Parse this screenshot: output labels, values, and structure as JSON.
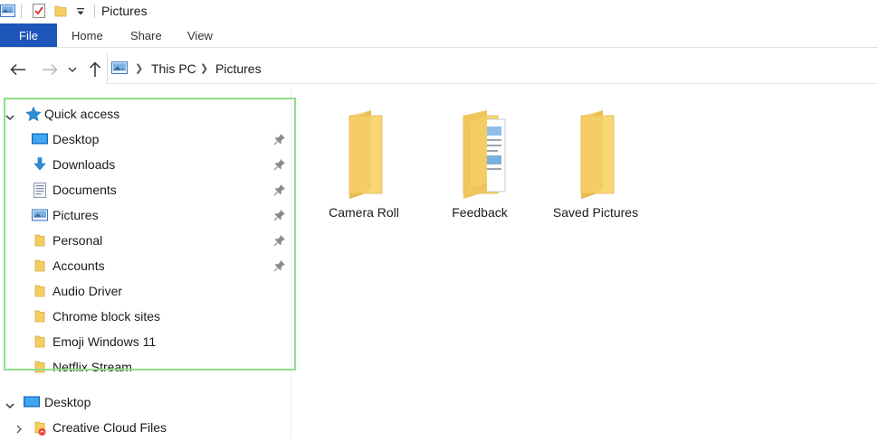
{
  "window": {
    "title": "Pictures"
  },
  "ribbon": {
    "tabs": [
      {
        "label": "File"
      },
      {
        "label": "Home"
      },
      {
        "label": "Share"
      },
      {
        "label": "View"
      }
    ]
  },
  "address": {
    "breadcrumbs": [
      "This PC",
      "Pictures"
    ]
  },
  "navpane": {
    "quick_access": {
      "label": "Quick access",
      "items": [
        {
          "label": "Desktop",
          "icon": "desktop-icon",
          "pinned": true
        },
        {
          "label": "Downloads",
          "icon": "downloads-icon",
          "pinned": true
        },
        {
          "label": "Documents",
          "icon": "documents-icon",
          "pinned": true
        },
        {
          "label": "Pictures",
          "icon": "pictures-icon",
          "pinned": true
        },
        {
          "label": "Personal",
          "icon": "folder-icon",
          "pinned": true
        },
        {
          "label": "Accounts",
          "icon": "folder-icon",
          "pinned": true
        },
        {
          "label": "Audio Driver",
          "icon": "folder-icon",
          "pinned": false
        },
        {
          "label": "Chrome block sites",
          "icon": "folder-icon",
          "pinned": false
        },
        {
          "label": "Emoji Windows 11",
          "icon": "folder-icon",
          "pinned": false
        },
        {
          "label": "Netflix Stream",
          "icon": "folder-icon",
          "pinned": false
        }
      ]
    },
    "desktop": {
      "label": "Desktop"
    },
    "creative_cloud": {
      "label": "Creative Cloud Files"
    }
  },
  "content": {
    "folders": [
      {
        "label": "Camera Roll"
      },
      {
        "label": "Feedback"
      },
      {
        "label": "Saved Pictures"
      }
    ]
  },
  "colors": {
    "file_tab": "#1e55b8",
    "folder": "#f5cd60",
    "highlight": "#8ee08a",
    "quick_access_star": "#2b8fd8"
  }
}
